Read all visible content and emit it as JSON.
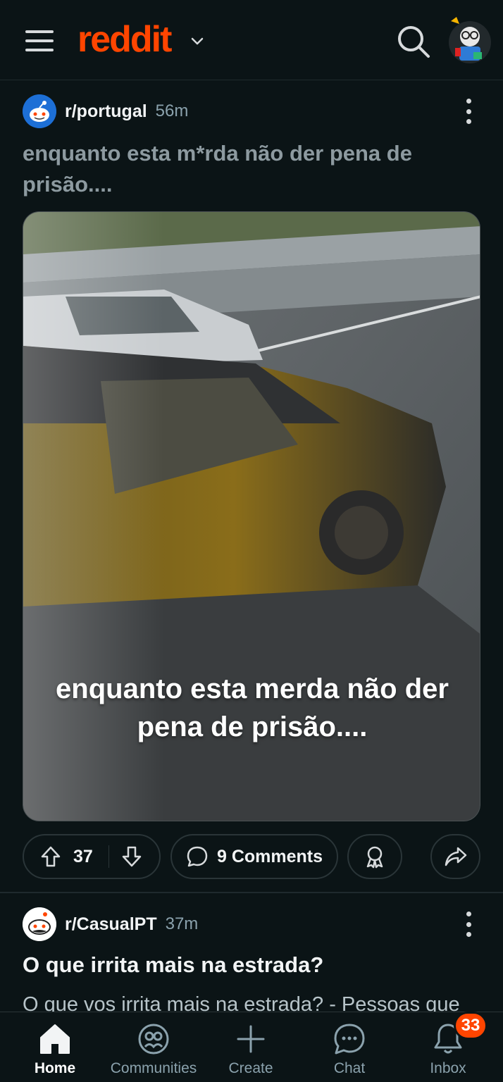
{
  "header": {
    "logo_text": "reddit",
    "icons": [
      "menu-icon",
      "chevron-down-icon",
      "search-icon",
      "user-avatar"
    ]
  },
  "post1": {
    "subreddit": "r/portugal",
    "time": "56m",
    "title": "enquanto esta m*rda não der pena de prisão....",
    "image_caption": "enquanto esta merda não der pena de prisão....",
    "upvotes": "37",
    "comments_label": "9 Comments"
  },
  "post2": {
    "subreddit": "r/CasualPT",
    "time": "37m",
    "title": "O que irrita mais na estrada?",
    "snippet": "O que vos irrita mais na estrada? - Pessoas que"
  },
  "bottom_nav": {
    "items": [
      {
        "label": "Home",
        "icon": "home-icon",
        "active": true
      },
      {
        "label": "Communities",
        "icon": "communities-icon",
        "active": false
      },
      {
        "label": "Create",
        "icon": "plus-icon",
        "active": false
      },
      {
        "label": "Chat",
        "icon": "chat-icon",
        "active": false
      },
      {
        "label": "Inbox",
        "icon": "bell-icon",
        "active": false
      }
    ],
    "inbox_badge": "33"
  },
  "colors": {
    "brand": "#ff4500",
    "background": "#0b1416",
    "muted_text": "#8ba2ad",
    "title_read": "#8d9aa0"
  }
}
